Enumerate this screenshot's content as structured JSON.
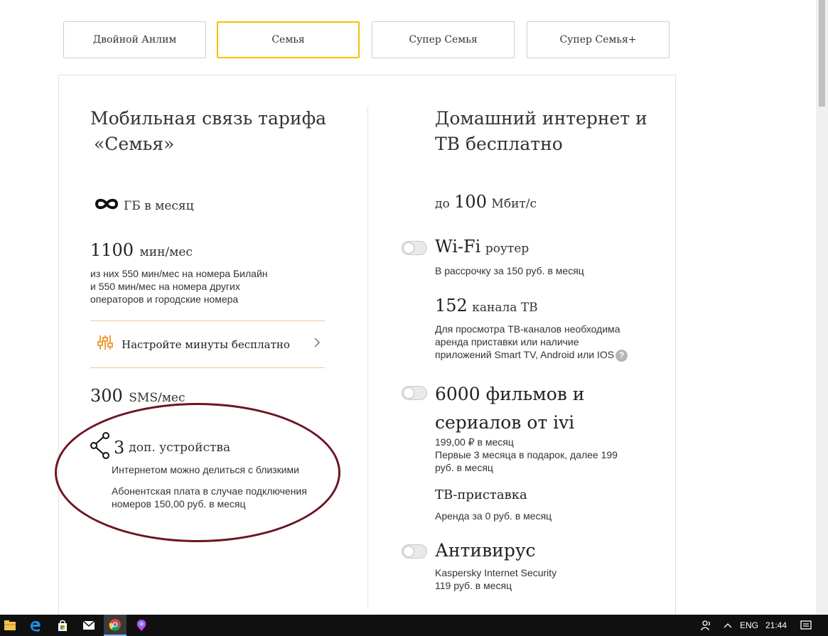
{
  "tabs": [
    {
      "label": "Двойной Анлим"
    },
    {
      "label": "Семья",
      "active": true
    },
    {
      "label": "Супер Семья"
    },
    {
      "label": "Супер Семья+"
    }
  ],
  "left": {
    "title_line1": "Мобильная связь тарифа",
    "title_line2": "«Семья»",
    "gb": {
      "icon": "infinity-icon",
      "unit": "ГБ в месяц"
    },
    "minutes": {
      "value": "1100",
      "unit": "мин/мес",
      "desc": [
        "из них 550 мин/мес на номера Билайн",
        "и 550 мин/мес на номера других",
        "операторов и городские номера"
      ]
    },
    "configure": {
      "label": "Настройте минуты бесплатно",
      "icon": "sliders-icon"
    },
    "sms": {
      "value": "300",
      "unit": "SMS/мес"
    },
    "devices": {
      "value": "3",
      "unit": "доп. устройства",
      "desc1": "Интернетом можно делиться с близкими",
      "desc2": [
        "Абонентская плата в случае подключения",
        "номеров 150,00 руб. в месяц"
      ]
    }
  },
  "right": {
    "title_line1": "Домашний интернет и",
    "title_line2": "ТВ бесплатно",
    "speed": {
      "prefix": "до",
      "value": "100",
      "unit": "Мбит/с"
    },
    "wifi": {
      "title": "Wi-Fi",
      "unit": "роутер",
      "desc": "В рассрочку за 150 руб. в месяц"
    },
    "tv": {
      "value": "152",
      "unit": "канала ТВ",
      "desc": [
        "Для просмотра ТВ-каналов необходима",
        "аренда приставки или наличие",
        "приложений Smart TV, Android или IOS"
      ],
      "help": "?"
    },
    "ivi": {
      "title_line1": "6000 фильмов и",
      "title_line2": "сериалов от ivi",
      "price": "199,00 ₽ в месяц",
      "desc": [
        "Первые 3 месяца в подарок, далее 199",
        "руб. в месяц"
      ]
    },
    "tvbox": {
      "title": "ТВ-приставка",
      "desc": "Аренда за 0 руб. в месяц"
    },
    "antivirus": {
      "title": "Антивирус",
      "desc1": "Kaspersky Internet Security",
      "desc2": "119 руб. в месяц"
    }
  },
  "taskbar": {
    "lang": "ENG",
    "time": "21:44"
  },
  "colors": {
    "accent": "#f2c000",
    "annotation": "#6e1423",
    "divider": "#f0c69a",
    "configure_icon": "#f0a040"
  }
}
